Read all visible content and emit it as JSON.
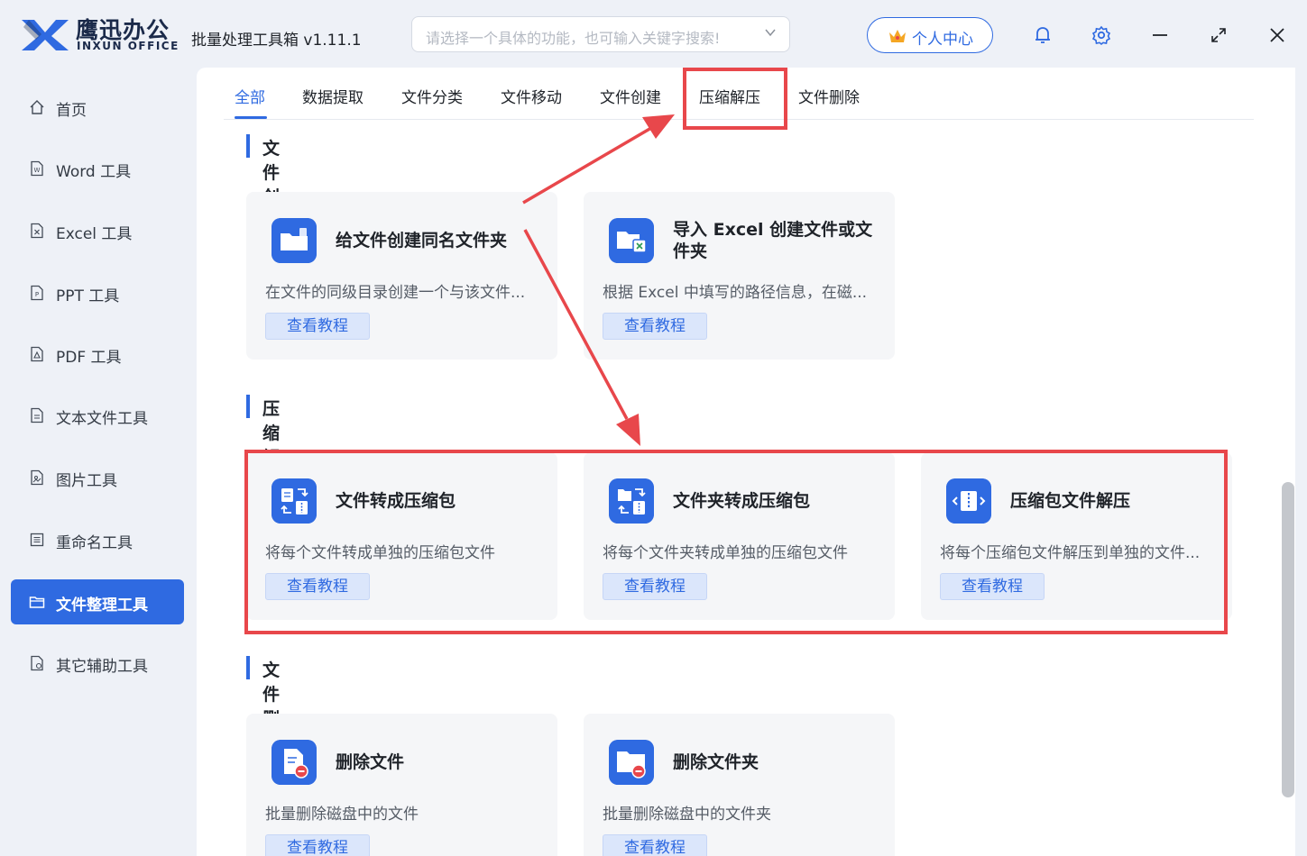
{
  "app": {
    "brand_cn": "鹰迅办公",
    "brand_en": "INXUN OFFICE",
    "title": "批量处理工具箱 v1.11.1"
  },
  "search": {
    "placeholder": "请选择一个具体的功能，也可输入关键字搜索!"
  },
  "header": {
    "user_center": "个人中心"
  },
  "sidebar": {
    "items": [
      {
        "label": "首页",
        "icon": "home-icon"
      },
      {
        "label": "Word 工具",
        "icon": "word-doc-icon"
      },
      {
        "label": "Excel 工具",
        "icon": "excel-doc-icon"
      },
      {
        "label": "PPT 工具",
        "icon": "ppt-doc-icon"
      },
      {
        "label": "PDF 工具",
        "icon": "pdf-doc-icon"
      },
      {
        "label": "文本文件工具",
        "icon": "text-file-icon"
      },
      {
        "label": "图片工具",
        "icon": "image-file-icon"
      },
      {
        "label": "重命名工具",
        "icon": "rename-icon"
      },
      {
        "label": "文件整理工具",
        "icon": "folder-icon",
        "active": true
      },
      {
        "label": "其它辅助工具",
        "icon": "other-tools-icon"
      }
    ]
  },
  "tabs": [
    {
      "label": "全部",
      "active": true
    },
    {
      "label": "数据提取"
    },
    {
      "label": "文件分类"
    },
    {
      "label": "文件移动"
    },
    {
      "label": "文件创建"
    },
    {
      "label": "压缩解压"
    },
    {
      "label": "文件删除"
    }
  ],
  "sections": {
    "create": {
      "title": "文件创建",
      "cards": [
        {
          "title": "给文件创建同名文件夹",
          "desc": "在文件的同级目录创建一个与该文件...",
          "button": "查看教程",
          "icon": "folder-create-icon"
        },
        {
          "title": "导入 Excel 创建文件或文件夹",
          "desc": "根据 Excel 中填写的路径信息，在磁...",
          "button": "查看教程",
          "icon": "excel-folder-icon"
        }
      ]
    },
    "compress": {
      "title": "压缩解压",
      "cards": [
        {
          "title": "文件转成压缩包",
          "desc": "将每个文件转成单独的压缩包文件",
          "button": "查看教程",
          "icon": "file-to-zip-icon"
        },
        {
          "title": "文件夹转成压缩包",
          "desc": "将每个文件夹转成单独的压缩包文件",
          "button": "查看教程",
          "icon": "folder-to-zip-icon"
        },
        {
          "title": "压缩包文件解压",
          "desc": "将每个压缩包文件解压到单独的文件...",
          "button": "查看教程",
          "icon": "unzip-icon"
        }
      ]
    },
    "delete": {
      "title": "文件删除",
      "cards": [
        {
          "title": "删除文件",
          "desc": "批量删除磁盘中的文件",
          "button": "查看教程",
          "icon": "delete-file-icon"
        },
        {
          "title": "删除文件夹",
          "desc": "批量删除磁盘中的文件夹",
          "button": "查看教程",
          "icon": "delete-folder-icon"
        }
      ]
    }
  },
  "colors": {
    "accent": "#2f6ae1",
    "highlight": "#e8474b",
    "crown": "#f5a623"
  }
}
